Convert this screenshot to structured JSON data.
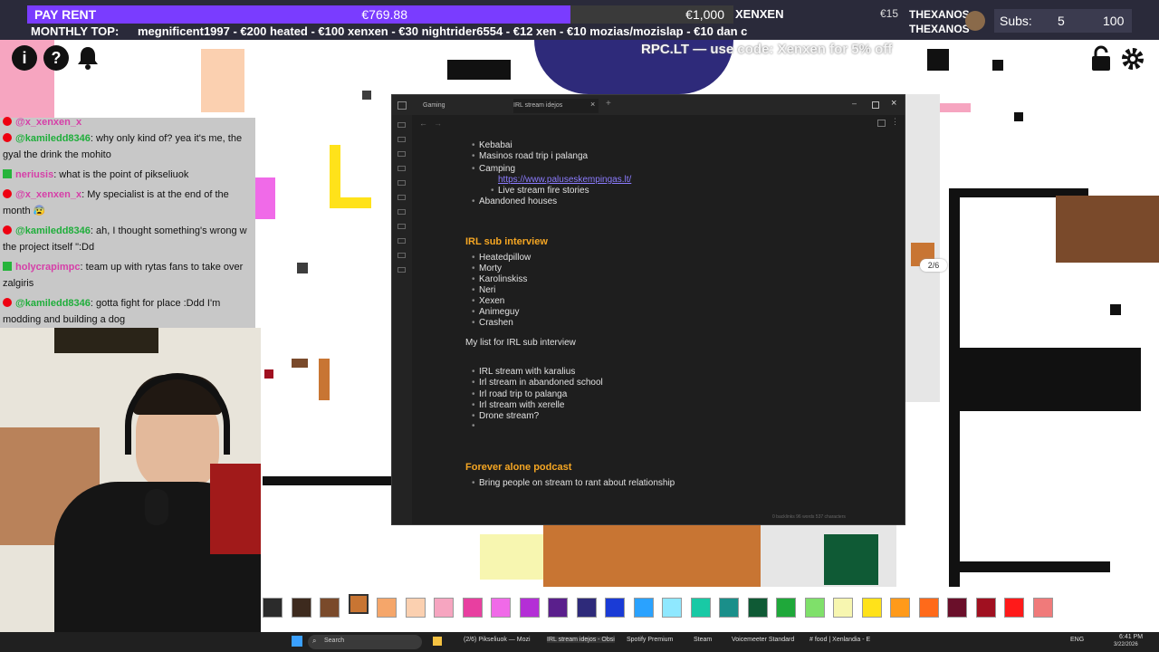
{
  "overlay": {
    "pay_rent": {
      "label": "PAY RENT",
      "amount": "€769.88"
    },
    "goal2": "€1,000",
    "tag_xenxen": "XENXEN",
    "tag_e15": "€15",
    "thexanos_1": "THEXANOS",
    "thexanos_2": "THEXANOS",
    "subs": {
      "label": "Subs:",
      "count": "5",
      "goal": "100"
    },
    "monthly_top": "MONTHLY TOP:",
    "ticker": "megnificent1997 - €200   heated - €100   xenxen - €30   nightrider6554 - €12   xen - €10   mozias/mozislap - €10   dan c",
    "rpc": "RPC.LT — use code: Xenxen for 5% off",
    "counter": "2/6"
  },
  "icons": {
    "info": "i",
    "help": "?",
    "bell": "bell-icon",
    "lock": "lock-icon",
    "gear": "gear-icon"
  },
  "chat": [
    {
      "user": "@kamiledd8346",
      "text": ": why only kind of? yea it's me, the gyal the drink the mohito",
      "source": "youtube"
    },
    {
      "user": "neriusis",
      "text": ": what is the point of pikseliuok",
      "source": "kick"
    },
    {
      "user": "@x_xenxen_x",
      "text": ": My specialist is at the end of the month 😰",
      "source": "youtube"
    },
    {
      "user": "@kamiledd8346",
      "text": ": ah, I thought something's wrong w the project itself \":Dd",
      "source": "youtube"
    },
    {
      "user": "holycrapimpc",
      "text": ": team up with rytas fans to take over zalgiris",
      "source": "kick"
    },
    {
      "user": "@kamiledd8346",
      "text": ": gotta fight for place :Ddd I'm modding and building a dog",
      "source": "youtube"
    }
  ],
  "chat_top_user": "@x_xenxen_x",
  "window": {
    "tabs": [
      "Gaming",
      "IRL stream idejos"
    ],
    "list1": [
      "Kebabai",
      "Masinos road trip i palanga",
      "Camping"
    ],
    "link": "https://www.paluseskempingas.lt/",
    "sub_item": "Live stream fire stories",
    "list1b": "Abandoned houses",
    "heading1": "IRL sub interview",
    "list2": [
      "Heatedpillow",
      "Morty",
      "Karolinskiss",
      "Neri",
      "Xexen",
      "Animeguy",
      "Crashen"
    ],
    "para": "My list for IRL sub interview",
    "list3": [
      "IRL stream with karalius",
      "Irl stream in abandoned school",
      "Irl road trip to palanga",
      "Irl stream with xerelle",
      "Drone stream?"
    ],
    "heading2": "Forever alone podcast",
    "list4": [
      "Bring people on stream to rant about relationship"
    ],
    "status": "0 backlinks   96 words   537 characters"
  },
  "palette": [
    "#2b2b2b",
    "#3d2a1e",
    "#7a4a2b",
    "#c87533",
    "#f5a66a",
    "#fbd0b0",
    "#f6a5c0",
    "#e83fa0",
    "#f06ae8",
    "#b42fd6",
    "#5a1f8c",
    "#2e2a7a",
    "#1a3bd6",
    "#2aa2ff",
    "#8fe8ff",
    "#19c9a5",
    "#1a8f8a",
    "#0f5a35",
    "#1fa83a",
    "#7fe06a",
    "#f7f6b0",
    "#ffe21a",
    "#ff9a1a",
    "#ff6a1a",
    "#6a0f2a",
    "#a01020",
    "#ff1a1a",
    "#f07a7a"
  ],
  "taskbar": {
    "search": "Search",
    "items": [
      "(2/6) Pikseliuok — Mozi",
      "IRL stream idejos - Obsi",
      "Steam",
      "Spotify Premium",
      "Voicemeeter Standard",
      "# food | Xenlandia - E"
    ],
    "lang": "ENG",
    "time": "6:41 PM",
    "date": "3/22/2026"
  }
}
